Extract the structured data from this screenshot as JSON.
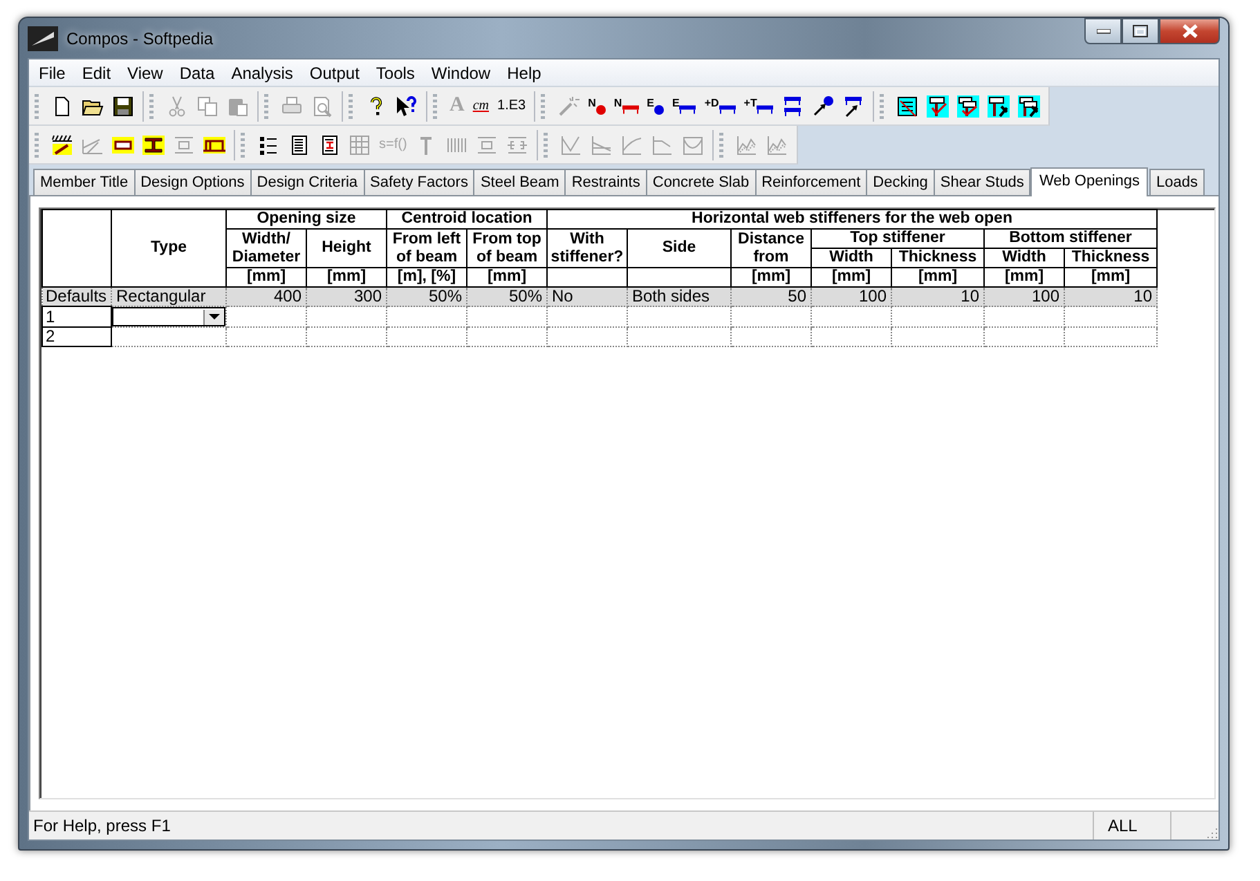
{
  "window": {
    "title": "Compos - Softpedia"
  },
  "menu": [
    "File",
    "Edit",
    "View",
    "Data",
    "Analysis",
    "Output",
    "Tools",
    "Window",
    "Help"
  ],
  "toolbars": [
    [
      [
        {
          "kind": "new",
          "disabled": false
        },
        {
          "kind": "open",
          "disabled": false
        },
        {
          "kind": "save",
          "disabled": false
        }
      ],
      [
        {
          "kind": "cut",
          "disabled": true
        },
        {
          "kind": "copy",
          "disabled": true
        },
        {
          "kind": "paste",
          "disabled": true
        }
      ],
      [
        {
          "kind": "print",
          "disabled": true
        },
        {
          "kind": "preview",
          "disabled": true
        }
      ],
      [
        {
          "kind": "help",
          "disabled": false
        },
        {
          "kind": "context_help",
          "disabled": false
        }
      ],
      [
        {
          "kind": "font",
          "label": "A",
          "disabled": true
        },
        {
          "kind": "units",
          "label": "cm",
          "disabled": false
        },
        {
          "kind": "number_format",
          "label": "1.E3",
          "disabled": false
        }
      ],
      [
        {
          "kind": "wand",
          "disabled": true
        },
        {
          "kind": "node_dot",
          "label": "N",
          "disabled": false
        },
        {
          "kind": "node_beam",
          "label": "N",
          "disabled": false
        },
        {
          "kind": "end_dot",
          "label": "E",
          "disabled": false
        },
        {
          "kind": "end_beam",
          "label": "E",
          "disabled": false
        },
        {
          "kind": "beam_down",
          "label": "+D",
          "disabled": false
        },
        {
          "kind": "beam_up",
          "label": "+T",
          "disabled": false
        },
        {
          "kind": "beam_pair",
          "disabled": false
        },
        {
          "kind": "arrow_dot",
          "disabled": false
        },
        {
          "kind": "arrow_beam",
          "disabled": false
        }
      ],
      [
        {
          "kind": "report",
          "disabled": false
        },
        {
          "kind": "check_single",
          "disabled": false
        },
        {
          "kind": "check_double",
          "disabled": false
        },
        {
          "kind": "tool_single",
          "disabled": false
        },
        {
          "kind": "tool_double",
          "disabled": false
        }
      ]
    ],
    [
      [
        {
          "kind": "hatch",
          "disabled": false
        },
        {
          "kind": "slope",
          "disabled": true
        },
        {
          "kind": "slab",
          "disabled": false
        },
        {
          "kind": "ibeam",
          "disabled": false
        },
        {
          "kind": "section",
          "disabled": true
        },
        {
          "kind": "deck",
          "disabled": false
        }
      ],
      [
        {
          "kind": "list",
          "disabled": false
        },
        {
          "kind": "doc",
          "disabled": false
        },
        {
          "kind": "doc_red",
          "disabled": false
        },
        {
          "kind": "grid",
          "disabled": true
        },
        {
          "kind": "formula",
          "label": "s=f()",
          "disabled": true
        },
        {
          "kind": "stud",
          "disabled": true
        },
        {
          "kind": "bars",
          "disabled": true
        },
        {
          "kind": "section",
          "disabled": true
        },
        {
          "kind": "section_split",
          "disabled": true
        }
      ],
      [
        {
          "kind": "graph_v",
          "disabled": true
        },
        {
          "kind": "graph_lines",
          "disabled": true
        },
        {
          "kind": "graph_curve",
          "disabled": true
        },
        {
          "kind": "graph_step",
          "disabled": true
        },
        {
          "kind": "graph_bowl",
          "disabled": true
        }
      ],
      [
        {
          "kind": "graph_area",
          "disabled": true
        },
        {
          "kind": "graph_area",
          "disabled": true
        }
      ]
    ]
  ],
  "tabs": [
    {
      "label": "Member Title",
      "selected": false
    },
    {
      "label": "Design Options",
      "selected": false
    },
    {
      "label": "Design Criteria",
      "selected": false
    },
    {
      "label": "Safety Factors",
      "selected": false
    },
    {
      "label": "Steel Beam",
      "selected": false
    },
    {
      "label": "Restraints",
      "selected": false
    },
    {
      "label": "Concrete Slab",
      "selected": false
    },
    {
      "label": "Reinforcement",
      "selected": false
    },
    {
      "label": "Decking",
      "selected": false
    },
    {
      "label": "Shear Studs",
      "selected": false
    },
    {
      "label": "Web Openings",
      "selected": true
    },
    {
      "label": "Loads",
      "selected": false
    }
  ],
  "table": {
    "header_rows": [
      [
        {
          "text": "",
          "rowspan": 4
        },
        {
          "text": "Type",
          "rowspan": 4
        },
        {
          "text": "Opening size",
          "colspan": 2
        },
        {
          "text": "Centroid location",
          "colspan": 2
        },
        {
          "text": "Horizontal web stiffeners for the web open",
          "colspan": 7
        }
      ],
      [
        {
          "text": "Width/ Diameter",
          "rowspan": 2
        },
        {
          "text": "Height",
          "rowspan": 2
        },
        {
          "text": "From left of beam",
          "rowspan": 2
        },
        {
          "text": "From top of beam",
          "rowspan": 2
        },
        {
          "text": "With stiffener?",
          "rowspan": 2
        },
        {
          "text": "Side",
          "rowspan": 2
        },
        {
          "text": "Distance from",
          "rowspan": 2
        },
        {
          "text": "Top stiffener",
          "colspan": 2
        },
        {
          "text": "Bottom stiffener",
          "colspan": 2
        }
      ],
      [
        {
          "text": "Width"
        },
        {
          "text": "Thickness"
        },
        {
          "text": "Width"
        },
        {
          "text": "Thickness"
        }
      ],
      [
        {
          "text": "[mm]"
        },
        {
          "text": "[mm]"
        },
        {
          "text": "[m], [%]"
        },
        {
          "text": "[mm]"
        },
        {
          "text": ""
        },
        {
          "text": ""
        },
        {
          "text": "[mm]"
        },
        {
          "text": "[mm]"
        },
        {
          "text": "[mm]"
        },
        {
          "text": "[mm]"
        },
        {
          "text": "[mm]"
        }
      ]
    ],
    "rows": [
      {
        "header": "Defaults",
        "kind": "defaults",
        "cells": [
          "Rectangular",
          "400",
          "300",
          "50%",
          "50%",
          "No",
          "Both sides",
          "50",
          "100",
          "10",
          "100",
          "10"
        ]
      },
      {
        "header": "1",
        "kind": "editing"
      },
      {
        "header": "2",
        "kind": "blank"
      }
    ]
  },
  "status_bar": {
    "message": "For Help, press F1",
    "mode": "ALL"
  }
}
